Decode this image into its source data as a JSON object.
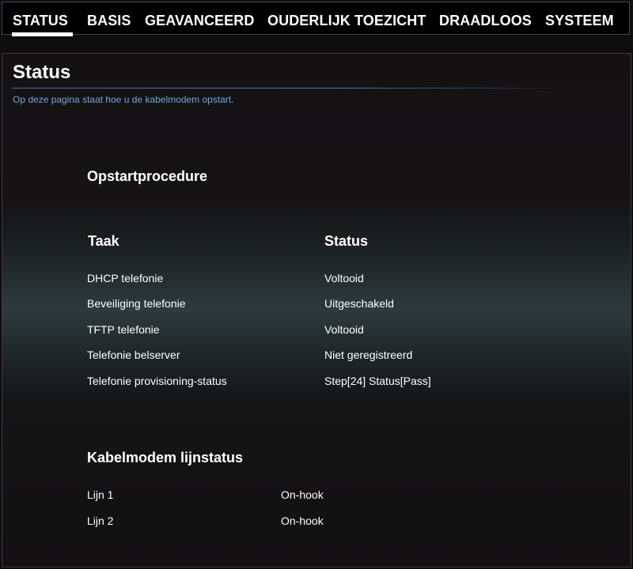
{
  "nav": {
    "tabs": [
      {
        "label": "STATUS",
        "active": true
      },
      {
        "label": "BASIS"
      },
      {
        "label": "GEAVANCEERD"
      },
      {
        "label": "OUDERLIJK TOEZICHT"
      },
      {
        "label": "DRAADLOOS"
      },
      {
        "label": "SYSTEEM"
      }
    ]
  },
  "page": {
    "title": "Status",
    "description": "Op deze pagina staat hoe u de kabelmodem opstart."
  },
  "startup": {
    "heading": "Opstartprocedure",
    "col_task": "Taak",
    "col_status": "Status",
    "rows": [
      {
        "task": "DHCP telefonie",
        "status": "Voltooid"
      },
      {
        "task": "Beveiliging telefonie",
        "status": "Uitgeschakeld"
      },
      {
        "task": "TFTP telefonie",
        "status": "Voltooid"
      },
      {
        "task": "Telefonie belserver",
        "status": "Niet geregistreerd"
      },
      {
        "task": "Telefonie provisioning-status",
        "status": "Step[24] Status[Pass]"
      }
    ]
  },
  "line_status": {
    "heading": "Kabelmodem lijnstatus",
    "rows": [
      {
        "line": "Lijn 1",
        "state": "On-hook"
      },
      {
        "line": "Lijn 2",
        "state": "On-hook"
      }
    ]
  },
  "colors": {
    "accent_blue": "#6aa8dc",
    "rule_blue": "#4a7bab",
    "background": "#0e0c0d"
  }
}
